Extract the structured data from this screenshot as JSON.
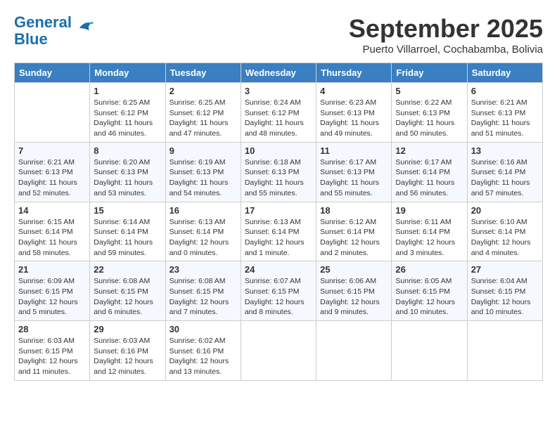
{
  "header": {
    "logo_line1": "General",
    "logo_line2": "Blue",
    "month_title": "September 2025",
    "location": "Puerto Villarroel, Cochabamba, Bolivia"
  },
  "days_of_week": [
    "Sunday",
    "Monday",
    "Tuesday",
    "Wednesday",
    "Thursday",
    "Friday",
    "Saturday"
  ],
  "weeks": [
    [
      {
        "day": "",
        "info": ""
      },
      {
        "day": "1",
        "info": "Sunrise: 6:25 AM\nSunset: 6:12 PM\nDaylight: 11 hours and 46 minutes."
      },
      {
        "day": "2",
        "info": "Sunrise: 6:25 AM\nSunset: 6:12 PM\nDaylight: 11 hours and 47 minutes."
      },
      {
        "day": "3",
        "info": "Sunrise: 6:24 AM\nSunset: 6:12 PM\nDaylight: 11 hours and 48 minutes."
      },
      {
        "day": "4",
        "info": "Sunrise: 6:23 AM\nSunset: 6:13 PM\nDaylight: 11 hours and 49 minutes."
      },
      {
        "day": "5",
        "info": "Sunrise: 6:22 AM\nSunset: 6:13 PM\nDaylight: 11 hours and 50 minutes."
      },
      {
        "day": "6",
        "info": "Sunrise: 6:21 AM\nSunset: 6:13 PM\nDaylight: 11 hours and 51 minutes."
      }
    ],
    [
      {
        "day": "7",
        "info": "Sunrise: 6:21 AM\nSunset: 6:13 PM\nDaylight: 11 hours and 52 minutes."
      },
      {
        "day": "8",
        "info": "Sunrise: 6:20 AM\nSunset: 6:13 PM\nDaylight: 11 hours and 53 minutes."
      },
      {
        "day": "9",
        "info": "Sunrise: 6:19 AM\nSunset: 6:13 PM\nDaylight: 11 hours and 54 minutes."
      },
      {
        "day": "10",
        "info": "Sunrise: 6:18 AM\nSunset: 6:13 PM\nDaylight: 11 hours and 55 minutes."
      },
      {
        "day": "11",
        "info": "Sunrise: 6:17 AM\nSunset: 6:13 PM\nDaylight: 11 hours and 55 minutes."
      },
      {
        "day": "12",
        "info": "Sunrise: 6:17 AM\nSunset: 6:14 PM\nDaylight: 11 hours and 56 minutes."
      },
      {
        "day": "13",
        "info": "Sunrise: 6:16 AM\nSunset: 6:14 PM\nDaylight: 11 hours and 57 minutes."
      }
    ],
    [
      {
        "day": "14",
        "info": "Sunrise: 6:15 AM\nSunset: 6:14 PM\nDaylight: 11 hours and 58 minutes."
      },
      {
        "day": "15",
        "info": "Sunrise: 6:14 AM\nSunset: 6:14 PM\nDaylight: 11 hours and 59 minutes."
      },
      {
        "day": "16",
        "info": "Sunrise: 6:13 AM\nSunset: 6:14 PM\nDaylight: 12 hours and 0 minutes."
      },
      {
        "day": "17",
        "info": "Sunrise: 6:13 AM\nSunset: 6:14 PM\nDaylight: 12 hours and 1 minute."
      },
      {
        "day": "18",
        "info": "Sunrise: 6:12 AM\nSunset: 6:14 PM\nDaylight: 12 hours and 2 minutes."
      },
      {
        "day": "19",
        "info": "Sunrise: 6:11 AM\nSunset: 6:14 PM\nDaylight: 12 hours and 3 minutes."
      },
      {
        "day": "20",
        "info": "Sunrise: 6:10 AM\nSunset: 6:14 PM\nDaylight: 12 hours and 4 minutes."
      }
    ],
    [
      {
        "day": "21",
        "info": "Sunrise: 6:09 AM\nSunset: 6:15 PM\nDaylight: 12 hours and 5 minutes."
      },
      {
        "day": "22",
        "info": "Sunrise: 6:08 AM\nSunset: 6:15 PM\nDaylight: 12 hours and 6 minutes."
      },
      {
        "day": "23",
        "info": "Sunrise: 6:08 AM\nSunset: 6:15 PM\nDaylight: 12 hours and 7 minutes."
      },
      {
        "day": "24",
        "info": "Sunrise: 6:07 AM\nSunset: 6:15 PM\nDaylight: 12 hours and 8 minutes."
      },
      {
        "day": "25",
        "info": "Sunrise: 6:06 AM\nSunset: 6:15 PM\nDaylight: 12 hours and 9 minutes."
      },
      {
        "day": "26",
        "info": "Sunrise: 6:05 AM\nSunset: 6:15 PM\nDaylight: 12 hours and 10 minutes."
      },
      {
        "day": "27",
        "info": "Sunrise: 6:04 AM\nSunset: 6:15 PM\nDaylight: 12 hours and 10 minutes."
      }
    ],
    [
      {
        "day": "28",
        "info": "Sunrise: 6:03 AM\nSunset: 6:15 PM\nDaylight: 12 hours and 11 minutes."
      },
      {
        "day": "29",
        "info": "Sunrise: 6:03 AM\nSunset: 6:16 PM\nDaylight: 12 hours and 12 minutes."
      },
      {
        "day": "30",
        "info": "Sunrise: 6:02 AM\nSunset: 6:16 PM\nDaylight: 12 hours and 13 minutes."
      },
      {
        "day": "",
        "info": ""
      },
      {
        "day": "",
        "info": ""
      },
      {
        "day": "",
        "info": ""
      },
      {
        "day": "",
        "info": ""
      }
    ]
  ]
}
